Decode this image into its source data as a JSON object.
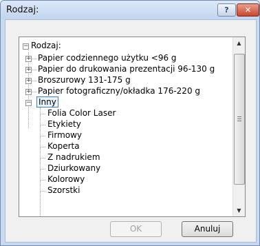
{
  "dialog": {
    "title": "Rodzaj:",
    "help_label": "?",
    "close_label": "✕"
  },
  "tree": {
    "root": "Rodzaj:",
    "items": [
      "Papier codziennego użytku <96 g",
      "Papier do drukowania prezentacji 96-130 g",
      "Broszurowy 131-175 g",
      "Papier fotograficzny/okładka 176-220 g",
      "Inny"
    ],
    "selected": "Inny",
    "children": [
      "Folia Color Laser",
      "Etykiety",
      "Firmowy",
      "Koperta",
      "Z nadrukiem",
      "Dziurkowany",
      "Kolorowy",
      "Szorstki"
    ]
  },
  "buttons": {
    "ok": "OK",
    "cancel": "Anuluj"
  },
  "icons": {
    "scroll_up": "▲",
    "scroll_down": "▼",
    "expand": "+",
    "collapse": "−"
  }
}
